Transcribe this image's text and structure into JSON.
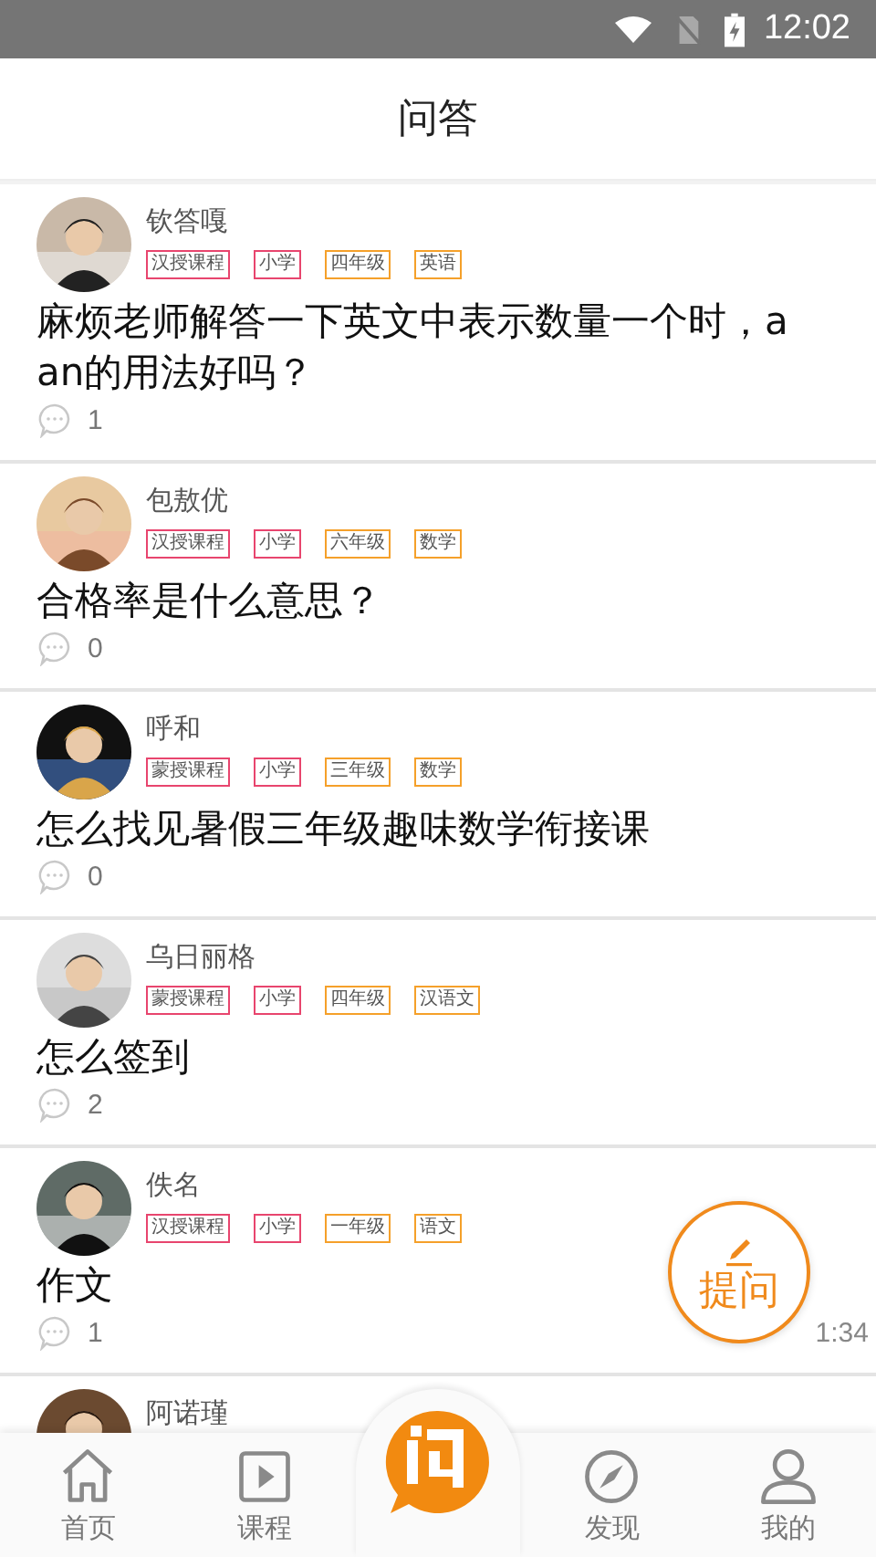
{
  "status_bar": {
    "time": "12:02"
  },
  "header": {
    "title": "问答"
  },
  "posts": [
    {
      "author": "钦答嘎",
      "tags": [
        {
          "label": "汉授课程",
          "color": "#e8456e"
        },
        {
          "label": "小学",
          "color": "#e8456e"
        },
        {
          "label": "四年级",
          "color": "#f5a02a"
        },
        {
          "label": "英语",
          "color": "#f5a02a"
        }
      ],
      "question": "麻烦老师解答一下英文中表示数量一个时，a an的用法好吗？",
      "comments": "1"
    },
    {
      "author": "包敖优",
      "tags": [
        {
          "label": "汉授课程",
          "color": "#e8456e"
        },
        {
          "label": "小学",
          "color": "#e8456e"
        },
        {
          "label": "六年级",
          "color": "#f5a02a"
        },
        {
          "label": "数学",
          "color": "#f5a02a"
        }
      ],
      "question": "合格率是什么意思？",
      "comments": "0"
    },
    {
      "author": "呼和",
      "tags": [
        {
          "label": "蒙授课程",
          "color": "#e8456e"
        },
        {
          "label": "小学",
          "color": "#e8456e"
        },
        {
          "label": "三年级",
          "color": "#f5a02a"
        },
        {
          "label": "数学",
          "color": "#f5a02a"
        }
      ],
      "question": "怎么找见暑假三年级趣味数学衔接课",
      "comments": "0"
    },
    {
      "author": "乌日丽格",
      "tags": [
        {
          "label": "蒙授课程",
          "color": "#e8456e"
        },
        {
          "label": "小学",
          "color": "#e8456e"
        },
        {
          "label": "四年级",
          "color": "#f5a02a"
        },
        {
          "label": "汉语文",
          "color": "#f5a02a"
        }
      ],
      "question": "怎么签到",
      "comments": "2"
    },
    {
      "author": "佚名",
      "tags": [
        {
          "label": "汉授课程",
          "color": "#e8456e"
        },
        {
          "label": "小学",
          "color": "#e8456e"
        },
        {
          "label": "一年级",
          "color": "#f5a02a"
        },
        {
          "label": "语文",
          "color": "#f5a02a"
        }
      ],
      "question": "作文",
      "comments": "1",
      "time": "1:34"
    },
    {
      "author": "阿诺瑾"
    }
  ],
  "fab": {
    "label": "提问"
  },
  "nav": [
    {
      "kind": "home",
      "label": "首页",
      "selected": false
    },
    {
      "kind": "course",
      "label": "课程",
      "selected": false
    },
    {
      "kind": "ask",
      "selected": true
    },
    {
      "kind": "discover",
      "label": "发现",
      "selected": false
    },
    {
      "kind": "me",
      "label": "我的",
      "selected": false
    }
  ]
}
